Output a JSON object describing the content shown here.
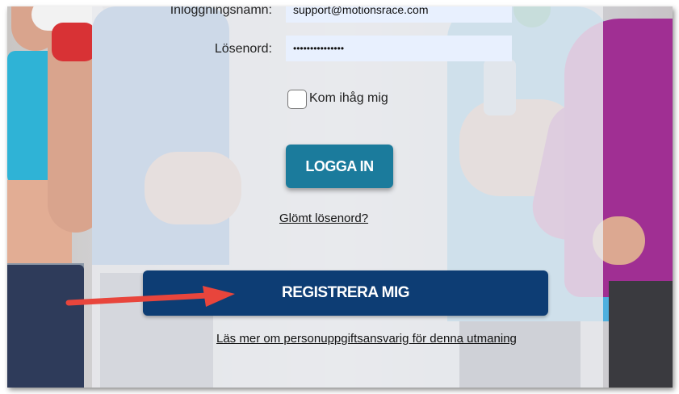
{
  "login_form": {
    "username_label": "Inloggningsnamn:",
    "username_value": "support@motionsrace.com",
    "password_label": "Lösenord:",
    "password_value": "•••••••••••••••",
    "remember_label": "Kom ihåg mig",
    "remember_checked": false,
    "login_button": "LOGGA IN",
    "forgot_link": "Glömt lösenord?"
  },
  "register_button": "REGISTRERA MIG",
  "privacy_link": "Läs mer om personuppgiftsansvarig för denna utmaning",
  "annotation": {
    "arrow_color": "#e8453c",
    "arrow_target": "register-button"
  },
  "colors": {
    "login_button": "#1b7b9c",
    "register_button": "#0d3d74",
    "input_background": "#e8f0fe"
  }
}
